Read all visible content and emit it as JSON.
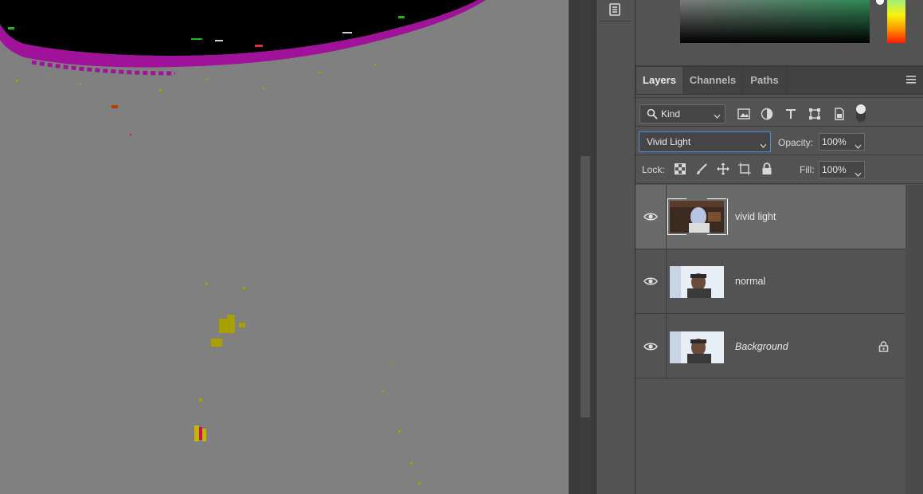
{
  "panel": {
    "tabs": [
      {
        "label": "Layers",
        "active": true
      },
      {
        "label": "Channels",
        "active": false
      },
      {
        "label": "Paths",
        "active": false
      }
    ]
  },
  "filter": {
    "kind_label": "Kind",
    "icons": [
      "image-filter-icon",
      "adjustment-filter-icon",
      "type-filter-icon",
      "shape-filter-icon",
      "smart-object-filter-icon"
    ]
  },
  "blend": {
    "mode": "Vivid Light",
    "opacity_label": "Opacity:",
    "opacity_value": "100%"
  },
  "lock": {
    "label": "Lock:",
    "fill_label": "Fill:",
    "fill_value": "100%"
  },
  "layers": [
    {
      "name": "vivid light",
      "visible": true,
      "selected": true,
      "locked": false,
      "italic": false
    },
    {
      "name": "normal",
      "visible": true,
      "selected": false,
      "locked": false,
      "italic": false
    },
    {
      "name": "Background",
      "visible": true,
      "selected": false,
      "locked": true,
      "italic": true
    }
  ],
  "colors": {
    "accent_focus": "#4a90d9",
    "canvas_gray": "#808080",
    "magenta_fringe": "#a0129a"
  }
}
